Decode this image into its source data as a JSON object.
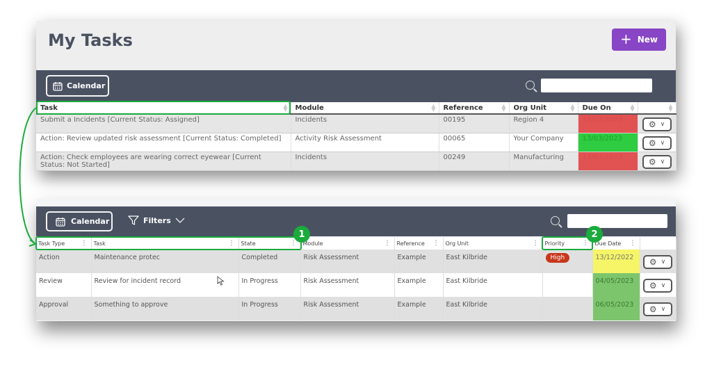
{
  "panel1": {
    "title": "My Tasks",
    "new_button": {
      "icon": "plus-icon",
      "label": "New"
    },
    "toolbar": {
      "calendar_label": "Calendar",
      "search_value": ""
    },
    "columns": [
      "Task",
      "Module",
      "Reference",
      "Org Unit",
      "Due On",
      ""
    ],
    "rows": [
      {
        "task": "Submit a Incidents [Current Status: Assigned]",
        "module": "Incidents",
        "reference": "00195",
        "org_unit": "Region 4",
        "due_on": "12/03/2023",
        "due_status": "overdue",
        "due_color": "#e15252"
      },
      {
        "task": "Action: Review updated risk assessment [Current Status: Completed]",
        "module": "Activity Risk Assessment",
        "reference": "00065",
        "org_unit": "Your Company",
        "due_on": "13/03/2023",
        "due_status": "ok",
        "due_color": "#2ecc40"
      },
      {
        "task": "Action: Check employees are wearing correct eyewear [Current Status: Not Started]",
        "module": "Incidents",
        "reference": "00249",
        "org_unit": "Manufacturing",
        "due_on": "14/03/2023",
        "due_status": "overdue",
        "due_color": "#e15252"
      }
    ]
  },
  "panel2": {
    "toolbar": {
      "calendar_label": "Calendar",
      "filters_label": "Filters",
      "search_value": ""
    },
    "columns": [
      "Task Type",
      "Task",
      "State",
      "Module",
      "Reference",
      "Org Unit",
      "Priority",
      "Due Date",
      ""
    ],
    "rows": [
      {
        "task_type": "Action",
        "task": "Maintenance protec",
        "state": "Completed",
        "module": "Risk Assessment",
        "reference": "Example",
        "org_unit": "East Kilbride",
        "priority": "High",
        "due_date": "13/12/2022",
        "due_color": "#f5f567"
      },
      {
        "task_type": "Review",
        "task": "Review for incident record",
        "state": "In Progress",
        "module": "Risk Assessment",
        "reference": "Example",
        "org_unit": "East Kilbride",
        "priority": "",
        "due_date": "04/05/2023",
        "due_color": "#7cc56c"
      },
      {
        "task_type": "Approval",
        "task": "Something to approve",
        "state": "In Progress",
        "module": "Risk Assessment",
        "reference": "Example",
        "org_unit": "East Kilbride",
        "priority": "",
        "due_date": "06/05/2023",
        "due_color": "#7cc56c"
      }
    ]
  },
  "annotations": {
    "callout_1": "1",
    "callout_2": "2",
    "highlight_color": "#1aab3c"
  },
  "colors": {
    "brand_purple": "#8845c6",
    "toolbar_bg": "#4a5262",
    "priority_high": "#c8371c"
  }
}
